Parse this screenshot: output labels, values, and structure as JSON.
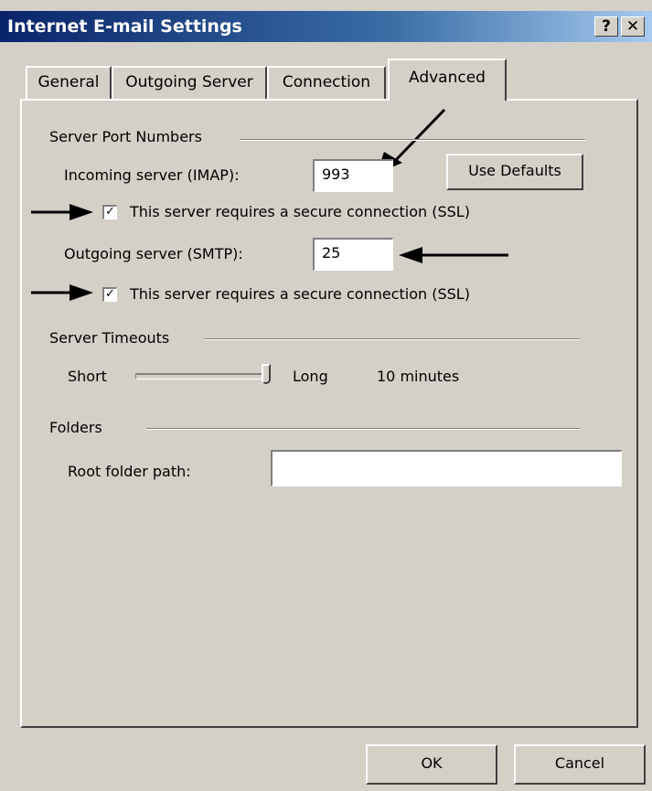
{
  "window": {
    "title": "Internet E-mail Settings",
    "help_button": "?",
    "close_button": "✕"
  },
  "tabs": [
    {
      "label": "General"
    },
    {
      "label": "Outgoing Server"
    },
    {
      "label": "Connection"
    },
    {
      "label": "Advanced",
      "active": true
    }
  ],
  "server_ports": {
    "group_label": "Server Port Numbers",
    "incoming_label": "Incoming server (IMAP):",
    "incoming_value": "993",
    "use_defaults_label": "Use Defaults",
    "incoming_ssl_label": "This server requires a secure connection (SSL)",
    "incoming_ssl_checked": true,
    "outgoing_label": "Outgoing server (SMTP):",
    "outgoing_value": "25",
    "outgoing_ssl_label": "This server requires a secure connection (SSL)",
    "outgoing_ssl_checked": true
  },
  "timeouts": {
    "group_label": "Server Timeouts",
    "short_label": "Short",
    "long_label": "Long",
    "value_text": "10 minutes",
    "slider_level": 1.0
  },
  "folders": {
    "group_label": "Folders",
    "root_label": "Root folder path:",
    "root_value": ""
  },
  "footer": {
    "ok_label": "OK",
    "cancel_label": "Cancel"
  },
  "colors": {
    "dialog_bg": "#d4d0c8",
    "title_bar": "#0a246a"
  }
}
